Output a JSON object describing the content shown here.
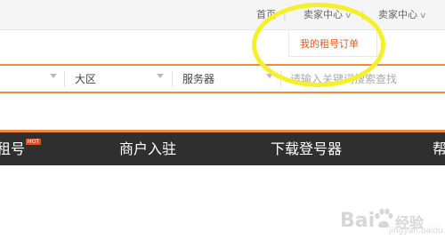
{
  "topbar": {
    "home": "首页",
    "seller_center_1": "卖家中心",
    "seller_center_2": "卖家中心"
  },
  "dropdown": {
    "my_orders": "我的租号订单"
  },
  "search": {
    "region_label": "大区",
    "server_label": "服务器",
    "keyword_placeholder": "请输入关键词搜索查找"
  },
  "nav": {
    "item_partial": "租号",
    "hot_badge": "HOT",
    "merchant": "商户入驻",
    "download": "下载登号器",
    "help_partial": "帮"
  },
  "annotation": {
    "circle_color": "#f4f02a"
  },
  "watermark": {
    "text_left": "Bai",
    "text_right": "经验",
    "sub": "jingyan.baidu.com"
  },
  "colors": {
    "accent": "#f08c3c",
    "nav_bg": "#2f2f2f",
    "dropdown_text": "#e85a1c"
  }
}
